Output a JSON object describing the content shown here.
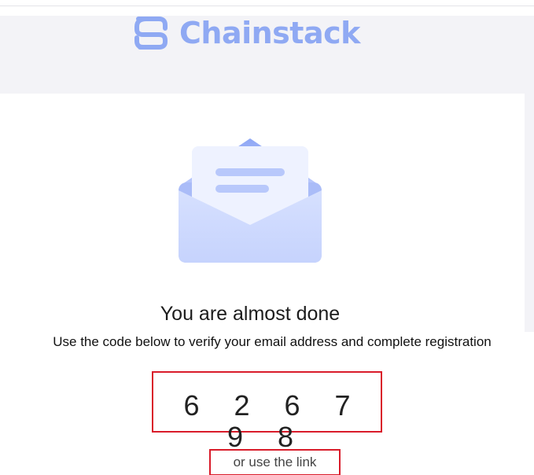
{
  "brand": {
    "name": "Chainstack",
    "logo_icon": "chainstack-logo-icon",
    "color": "#8fa9f3"
  },
  "hero": {
    "illustration": "open-envelope-icon"
  },
  "content": {
    "headline": "You are almost done",
    "subtext": "Use the code below to verify your email address and complete registration",
    "code": "6 2 6 7 9 8",
    "alternative_label": "or use the link"
  },
  "colors": {
    "highlight_border": "#d91c2a",
    "header_background": "#f3f3f7",
    "link": "#5d7fe0"
  }
}
